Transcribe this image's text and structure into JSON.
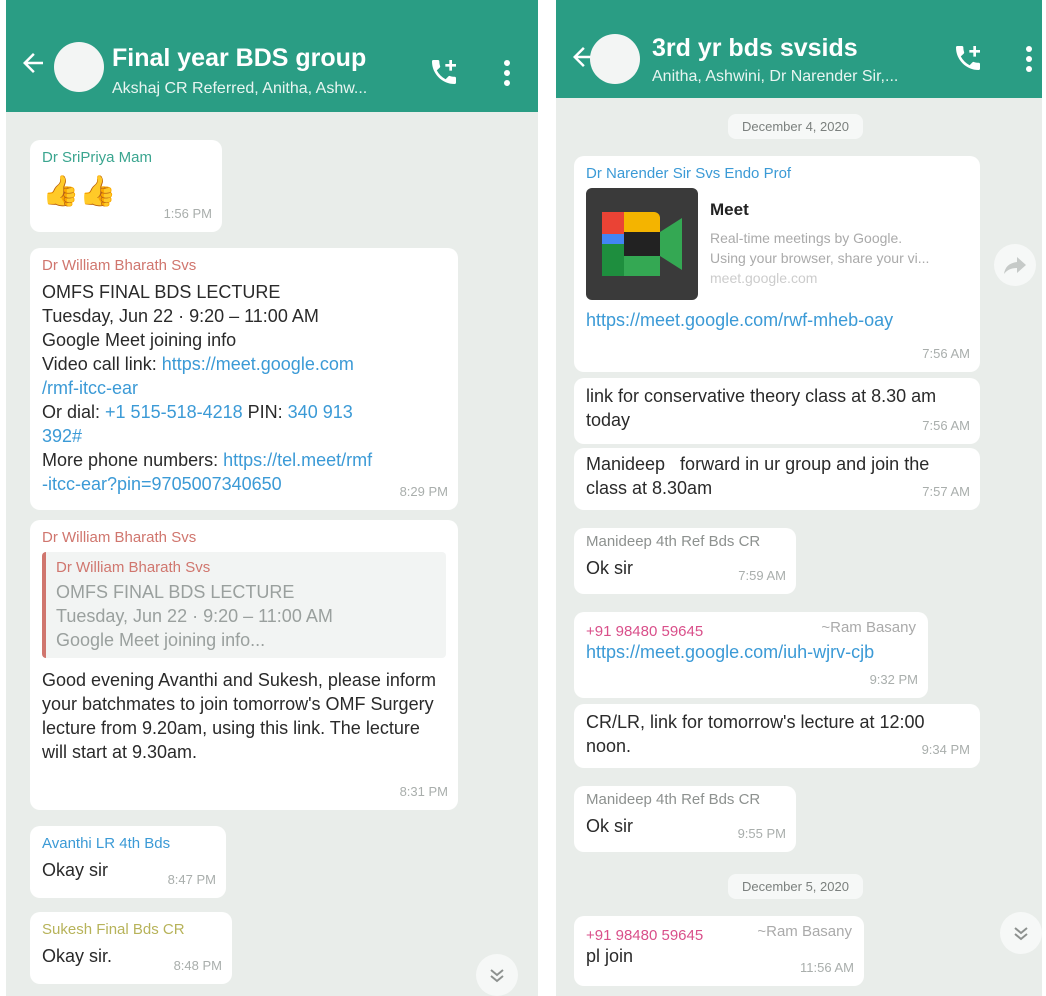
{
  "left": {
    "header": {
      "title": "Final year BDS group",
      "subtitle": "Akshaj CR Referred, Anitha, Ashw..."
    },
    "messages": [
      {
        "sender": "Dr SriPriya Mam",
        "text": "👍👍",
        "time": "1:56 PM"
      },
      {
        "sender": "Dr William Bharath Svs",
        "lines": [
          "OMFS FINAL BDS LECTURE",
          "Tuesday, Jun 22 · 9:20 – 11:00 AM",
          "Google Meet joining info"
        ],
        "video_label": "Video call link: ",
        "video_link_1": "https://meet.google.com",
        "video_link_2": "/rmf-itcc-ear",
        "dial_label": "Or dial: ",
        "dial_number": "+1 515-518-4218",
        "pin_label": " PIN: ",
        "pin_1": "340 913",
        "pin_2": "392#",
        "more_label": "More phone numbers: ",
        "more_link_1": "https://tel.meet/rmf",
        "more_link_2": "-itcc-ear?pin=9705007340650",
        "time": "8:29 PM"
      },
      {
        "sender": "Dr William Bharath Svs",
        "quote_sender": "Dr William Bharath Svs",
        "quote_lines": [
          "OMFS FINAL BDS LECTURE",
          "Tuesday, Jun 22 · 9:20 – 11:00 AM",
          "Google Meet joining info..."
        ],
        "text": "Good evening Avanthi and Sukesh, please inform your batchmates to join tomorrow's OMF Surgery lecture from 9.20am, using this link. The lecture will start at 9.30am.",
        "time": "8:31 PM"
      },
      {
        "sender": "Avanthi LR 4th Bds",
        "text": "Okay sir",
        "time": "8:47 PM"
      },
      {
        "sender": "Sukesh Final Bds CR",
        "text": "Okay sir.",
        "time": "8:48 PM"
      }
    ]
  },
  "right": {
    "header": {
      "title": "3rd yr bds svsids",
      "subtitle": "Anitha, Ashwini, Dr Narender Sir,..."
    },
    "date1": "December 4, 2020",
    "date2": "December 5, 2020",
    "messages": [
      {
        "sender": "Dr Narender Sir Svs Endo Prof",
        "preview_title": "Meet",
        "preview_desc": [
          "Real-time meetings by Google.",
          "Using your browser, share your vi...",
          "meet.google.com"
        ],
        "link": "https://meet.google.com/rwf-mheb-oay",
        "time": "7:56 AM"
      },
      {
        "text": "link for conservative theory class at 8.30 am today",
        "time": "7:56 AM"
      },
      {
        "text": "Manideep   forward in ur group and join the class at 8.30am",
        "time": "7:57 AM"
      },
      {
        "sender": "Manideep 4th Ref Bds CR",
        "text": "Ok sir",
        "time": "7:59 AM"
      },
      {
        "sender": "+91 98480 59645",
        "alias": "~Ram Basany",
        "link": "https://meet.google.com/iuh-wjrv-cjb",
        "time": "9:32 PM"
      },
      {
        "text": "CR/LR, link for tomorrow's lecture at 12:00 noon.",
        "time": "9:34 PM"
      },
      {
        "sender": "Manideep 4th Ref Bds CR",
        "text": "Ok sir",
        "time": "9:55 PM"
      },
      {
        "sender": "+91 98480 59645",
        "alias": "~Ram Basany",
        "text": "pl join",
        "time": "11:56 AM"
      }
    ]
  },
  "colors": {
    "header": "#2a9d84",
    "chat_bg": "#e9edea",
    "link": "#3b9ad6",
    "sender_green": "#3aa58f",
    "sender_red": "#d0766e",
    "sender_blue": "#3b9ad6",
    "sender_olive": "#b7b35a",
    "sender_gray": "#8d918f",
    "sender_pink": "#d94f8a"
  },
  "icons": [
    "back-arrow-icon",
    "add-call-icon",
    "more-vert-icon",
    "forward-icon",
    "scroll-down-icon"
  ]
}
